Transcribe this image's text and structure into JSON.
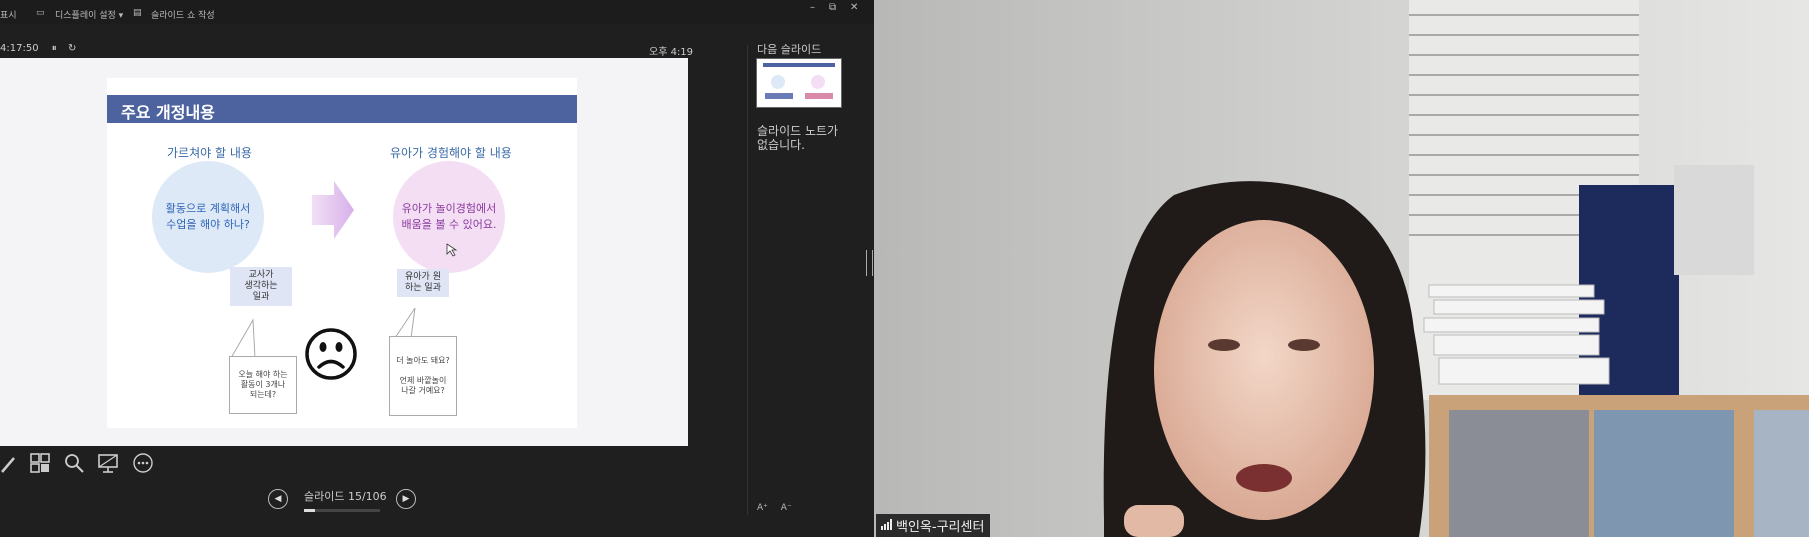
{
  "topbar": {
    "item1": "표시",
    "item2": "디스플레이 설정 ▾",
    "item3": "슬라이드 쇼 작성",
    "min": "–",
    "restore": "⧉",
    "close": "✕"
  },
  "presenter": {
    "elapsed": "4:17:50",
    "pause": "⏸",
    "reset": "↻",
    "clock": "오후 4:19",
    "next_slide_label": "다음 슬라이드",
    "notes_text": "슬라이드 노트가 없습니다.",
    "slide_counter": "슬라이드 15/106",
    "progress_fraction": 0.14,
    "prev": "◀",
    "next": "▶",
    "font_up": "A⁺",
    "font_down": "A⁻"
  },
  "slide": {
    "title": "주요 개정내용",
    "left_heading": "가르쳐야 할 내용",
    "right_heading": "유아가 경험해야 할 내용",
    "left_circle": "활동으로 계획해서\n수업을 해야 하나?",
    "right_circle": "유아가 놀이경험에서\n배움을 볼 수 있어요.",
    "label_teacher": "교사가\n생각하는\n일과",
    "label_child": "유아가 원\n하는 일과",
    "bubble_teacher": "오늘 해야 하는\n활동이 3개나\n되는데?",
    "bubble_child": "더 놀아도 돼요?\n\n언제 바깥놀이\n나갈 거예요?"
  },
  "video": {
    "participant_name": "백인옥-구리센터"
  }
}
